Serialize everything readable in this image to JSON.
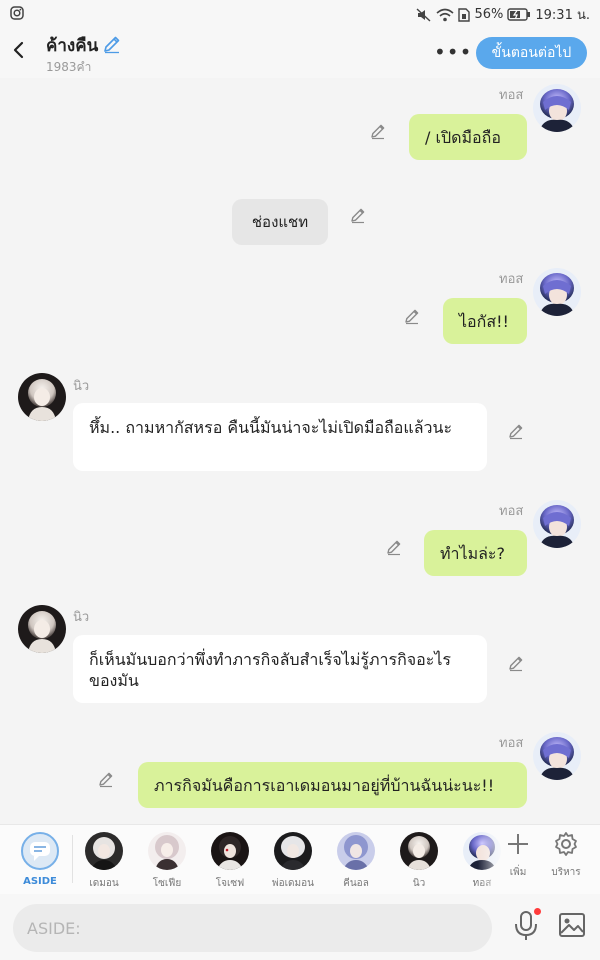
{
  "status": {
    "battery": "56%",
    "time": "19:31 น."
  },
  "header": {
    "title": "ค้างคืน",
    "word_count": "1983คำ",
    "more": "•••",
    "next_button": "ขั้นตอนต่อไป"
  },
  "messages": [
    {
      "name": "ทอส",
      "text": "/ เปิดมือถือ"
    },
    {
      "text": "ช่องแชท"
    },
    {
      "name": "ทอส",
      "text": "ไอกัส!!"
    },
    {
      "name": "นิว",
      "text": "หึ้ม.. ถามหากัสหรอ คืนนี้มันน่าจะไม่เปิดมือถือแล้วนะ"
    },
    {
      "name": "ทอส",
      "text": "ทำไมล่ะ?"
    },
    {
      "name": "นิว",
      "text": "ก็เห็นมันบอกว่าพึ่งทำภารกิจลับสำเร็จไม่รู้ภารกิจอะไรของมัน"
    },
    {
      "name": "ทอส",
      "text": "ภารกิจมันคือการเอาเดมอนมาอยู่ที่บ้านฉันน่ะนะ!!"
    }
  ],
  "characters": [
    {
      "label": "ASIDE"
    },
    {
      "label": "เดมอน"
    },
    {
      "label": "โซเฟีย"
    },
    {
      "label": "โจเซฟ"
    },
    {
      "label": "พ่อเดมอน"
    },
    {
      "label": "คีนอล"
    },
    {
      "label": "นิว"
    },
    {
      "label": "ทอส"
    }
  ],
  "tools": {
    "add_label": "เพิ่ม",
    "manage_label": "บริหาร"
  },
  "input": {
    "placeholder": "ASIDE:"
  },
  "colors": {
    "accent": "#5aa8ec",
    "user_bubble": "#d9f29a",
    "other_bubble": "#ffffff",
    "system_bubble": "#e6e6e6"
  },
  "icons": [
    "instagram-icon",
    "mute-icon",
    "wifi-icon",
    "sim-icon",
    "battery-icon",
    "back-icon",
    "pencil-icon",
    "more-icon",
    "chat-bubble-icon",
    "plus-icon",
    "gear-icon",
    "mic-icon",
    "image-icon"
  ]
}
